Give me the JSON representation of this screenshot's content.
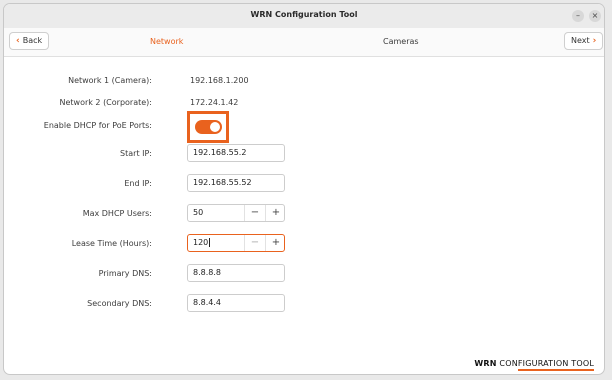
{
  "window": {
    "title": "WRN Configuration Tool",
    "min_glyph": "–",
    "close_glyph": "×"
  },
  "nav": {
    "back_label": "Back",
    "next_label": "Next",
    "tabs": [
      {
        "label": "Network",
        "active": true
      },
      {
        "label": "Cameras",
        "active": false
      }
    ]
  },
  "form": {
    "network1": {
      "label": "Network 1 (Camera):",
      "value": "192.168.1.200"
    },
    "network2": {
      "label": "Network 2 (Corporate):",
      "value": "172.24.1.42"
    },
    "dhcp": {
      "label": "Enable DHCP for PoE Ports:",
      "enabled": true
    },
    "start_ip": {
      "label": "Start IP:",
      "value": "192.168.55.2"
    },
    "end_ip": {
      "label": "End IP:",
      "value": "192.168.55.52"
    },
    "max_users": {
      "label": "Max DHCP Users:",
      "value": "50",
      "minus": "−",
      "plus": "+"
    },
    "lease_time": {
      "label": "Lease Time (Hours):",
      "value": "120",
      "minus": "−",
      "plus": "+"
    },
    "primary_dns": {
      "label": "Primary DNS:",
      "value": "8.8.8.8"
    },
    "secondary_dns": {
      "label": "Secondary DNS:",
      "value": "8.8.4.4"
    }
  },
  "brand": {
    "bold": "WRN",
    "rest": " CONFIGURATION TOOL"
  },
  "colors": {
    "accent": "#e9621e",
    "text": "#3c3c3c",
    "titlebar": "#ebebeb"
  },
  "icons": {
    "back": "chevron-left-icon",
    "next": "chevron-right-icon"
  }
}
